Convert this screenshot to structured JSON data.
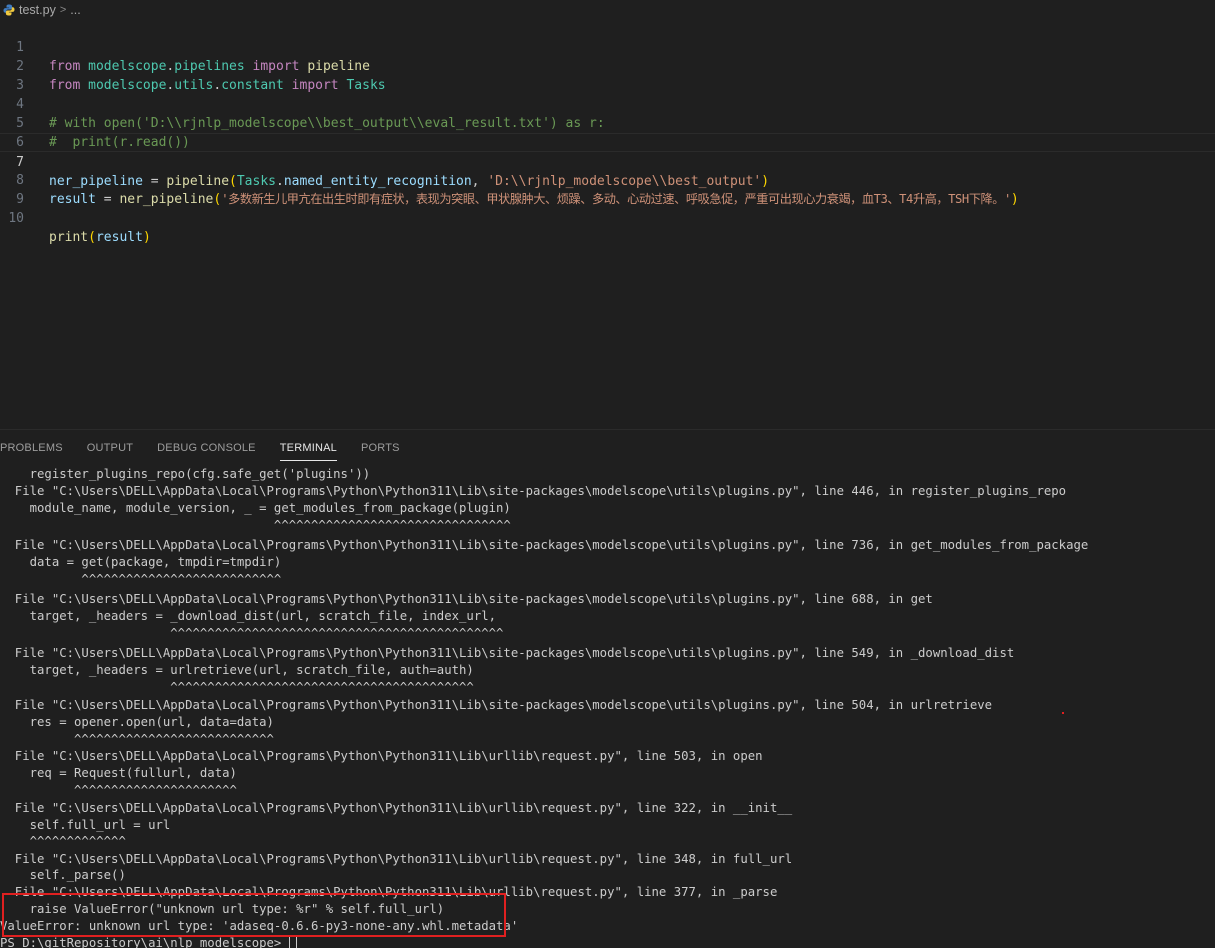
{
  "breadcrumb": {
    "file": "test.py",
    "separator": ">",
    "rest": "..."
  },
  "editor": {
    "line_numbers": [
      "1",
      "2",
      "3",
      "4",
      "5",
      "6",
      "7",
      "8",
      "9",
      "10"
    ],
    "l1": {
      "kw1": "from",
      "mod1": "modelscope",
      "dot1": ".",
      "mod2": "pipelines",
      "kw2": "import",
      "id": "pipeline"
    },
    "l2": {
      "kw1": "from",
      "mod1": "modelscope",
      "dot1": ".",
      "mod2": "utils",
      "dot2": ".",
      "mod3": "constant",
      "kw2": "import",
      "id": "Tasks"
    },
    "l4": "# with open('D:\\\\rjnlp_modelscope\\\\best_output\\\\eval_result.txt') as r:",
    "l5": "#  print(r.read())",
    "l7": {
      "var": "ner_pipeline",
      "eq": " = ",
      "fn": "pipeline",
      "open": "(",
      "cls": "Tasks",
      "dot": ".",
      "attr": "named_entity_recognition",
      "comma": ", ",
      "str": "'D:\\\\rjnlp_modelscope\\\\best_output'",
      "close": ")"
    },
    "l8": {
      "var": "result",
      "eq": " = ",
      "fn": "ner_pipeline",
      "open": "(",
      "str": "'多数新生儿甲亢在出生时即有症状，表现为突眼、甲状腺肿大、烦躁、多动、心动过速、呼吸急促，严重可出现心力衰竭，血T3、T4升高，TSH下降。'",
      "close": ")"
    },
    "l10": {
      "fn": "print",
      "open": "(",
      "arg": "result",
      "close": ")"
    }
  },
  "panel_tabs": [
    "PROBLEMS",
    "OUTPUT",
    "DEBUG CONSOLE",
    "TERMINAL",
    "PORTS"
  ],
  "terminal_lines": [
    "    register_plugins_repo(cfg.safe_get('plugins'))",
    "  File \"C:\\Users\\DELL\\AppData\\Local\\Programs\\Python\\Python311\\Lib\\site-packages\\modelscope\\utils\\plugins.py\", line 446, in register_plugins_repo",
    "    module_name, module_version, _ = get_modules_from_package(plugin)",
    "                                     ^^^^^^^^^^^^^^^^^^^^^^^^^^^^^^^^",
    "",
    "  File \"C:\\Users\\DELL\\AppData\\Local\\Programs\\Python\\Python311\\Lib\\site-packages\\modelscope\\utils\\plugins.py\", line 736, in get_modules_from_package",
    "    data = get(package, tmpdir=tmpdir)",
    "           ^^^^^^^^^^^^^^^^^^^^^^^^^^^",
    "",
    "  File \"C:\\Users\\DELL\\AppData\\Local\\Programs\\Python\\Python311\\Lib\\site-packages\\modelscope\\utils\\plugins.py\", line 688, in get",
    "    target, _headers = _download_dist(url, scratch_file, index_url,",
    "                       ^^^^^^^^^^^^^^^^^^^^^^^^^^^^^^^^^^^^^^^^^^^^^",
    "",
    "  File \"C:\\Users\\DELL\\AppData\\Local\\Programs\\Python\\Python311\\Lib\\site-packages\\modelscope\\utils\\plugins.py\", line 549, in _download_dist",
    "    target, _headers = urlretrieve(url, scratch_file, auth=auth)",
    "                       ^^^^^^^^^^^^^^^^^^^^^^^^^^^^^^^^^^^^^^^^^",
    "",
    "  File \"C:\\Users\\DELL\\AppData\\Local\\Programs\\Python\\Python311\\Lib\\site-packages\\modelscope\\utils\\plugins.py\", line 504, in urlretrieve",
    "    res = opener.open(url, data=data)",
    "          ^^^^^^^^^^^^^^^^^^^^^^^^^^^",
    "",
    "  File \"C:\\Users\\DELL\\AppData\\Local\\Programs\\Python\\Python311\\Lib\\urllib\\request.py\", line 503, in open",
    "    req = Request(fullurl, data)",
    "          ^^^^^^^^^^^^^^^^^^^^^^",
    "",
    "  File \"C:\\Users\\DELL\\AppData\\Local\\Programs\\Python\\Python311\\Lib\\urllib\\request.py\", line 322, in __init__",
    "    self.full_url = url",
    "    ^^^^^^^^^^^^^",
    "",
    "  File \"C:\\Users\\DELL\\AppData\\Local\\Programs\\Python\\Python311\\Lib\\urllib\\request.py\", line 348, in full_url",
    "    self._parse()",
    "  File \"C:\\Users\\DELL\\AppData\\Local\\Programs\\Python\\Python311\\Lib\\urllib\\request.py\", line 377, in _parse",
    "    raise ValueError(\"unknown url type: %r\" % self.full_url)",
    "ValueError: unknown url type: 'adaseq-0.6.6-py3-none-any.whl.metadata'",
    "PS D:\\gitRepository\\ai\\nlp_modelscope> "
  ],
  "colors": {
    "background": "#1f1f1f",
    "highlight_box": "#e02020",
    "keyword": "#c586c0",
    "string": "#ce9178",
    "comment": "#6a9955"
  }
}
